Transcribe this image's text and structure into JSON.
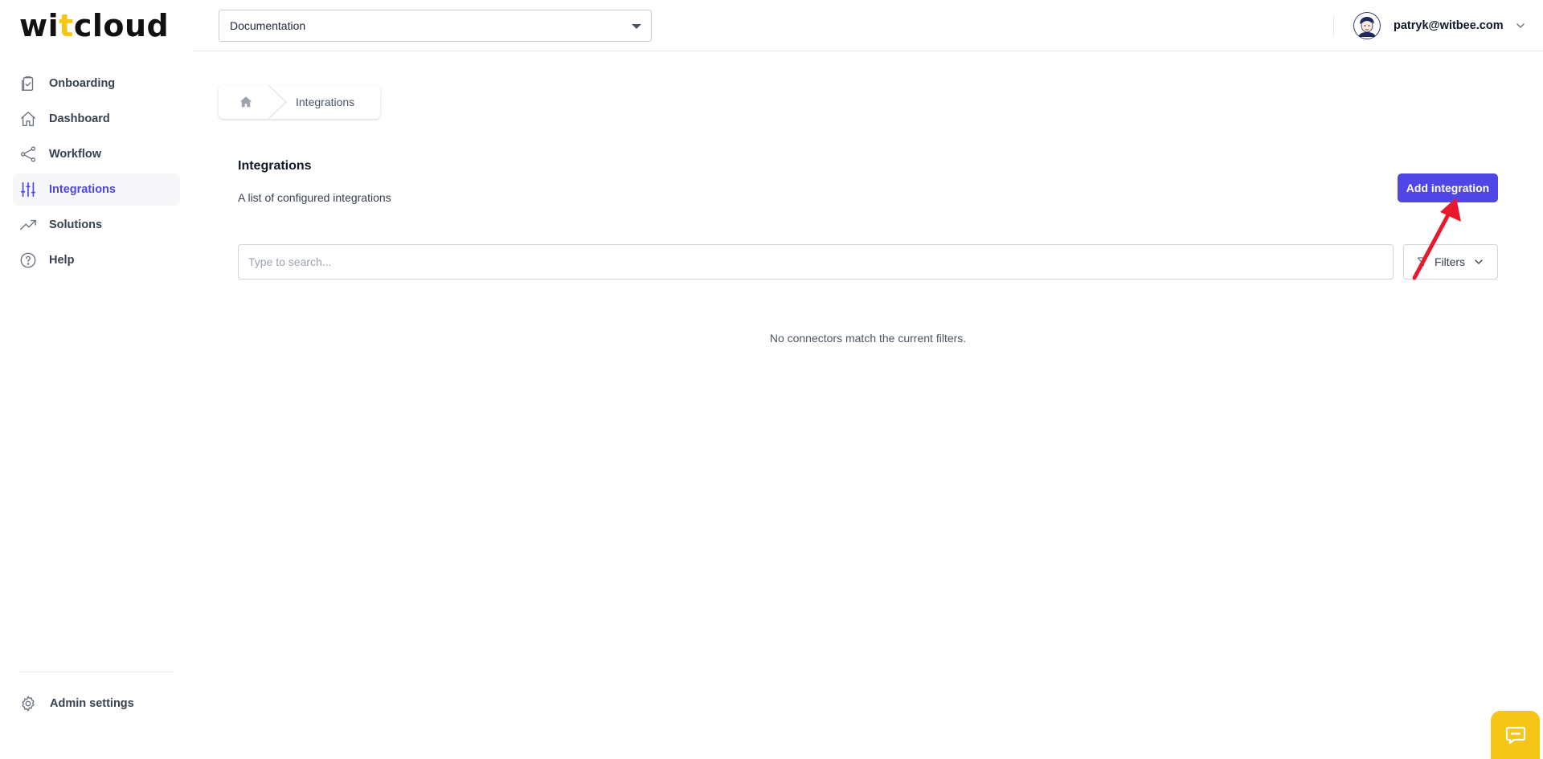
{
  "brand": {
    "logo_left": "wi",
    "logo_accent": "t",
    "logo_right": "cloud",
    "accent_color": "#f5c518",
    "primary_color": "#4f46e5"
  },
  "sidebar": {
    "items": [
      {
        "label": "Onboarding",
        "icon": "clipboard-check-icon",
        "active": false
      },
      {
        "label": "Dashboard",
        "icon": "home-icon",
        "active": false
      },
      {
        "label": "Workflow",
        "icon": "share-nodes-icon",
        "active": false
      },
      {
        "label": "Integrations",
        "icon": "sliders-icon",
        "active": true
      },
      {
        "label": "Solutions",
        "icon": "trending-up-icon",
        "active": false
      },
      {
        "label": "Help",
        "icon": "question-circle-icon",
        "active": false
      }
    ],
    "admin_label": "Admin settings"
  },
  "header": {
    "project": "Documentation",
    "user_email": "patryk@witbee.com"
  },
  "breadcrumb": {
    "current": "Integrations"
  },
  "main": {
    "title": "Integrations",
    "subtitle": "A list of configured integrations",
    "add_button": "Add integration",
    "search_placeholder": "Type to search...",
    "filters_label": "Filters",
    "empty_message": "No connectors match the current filters."
  }
}
